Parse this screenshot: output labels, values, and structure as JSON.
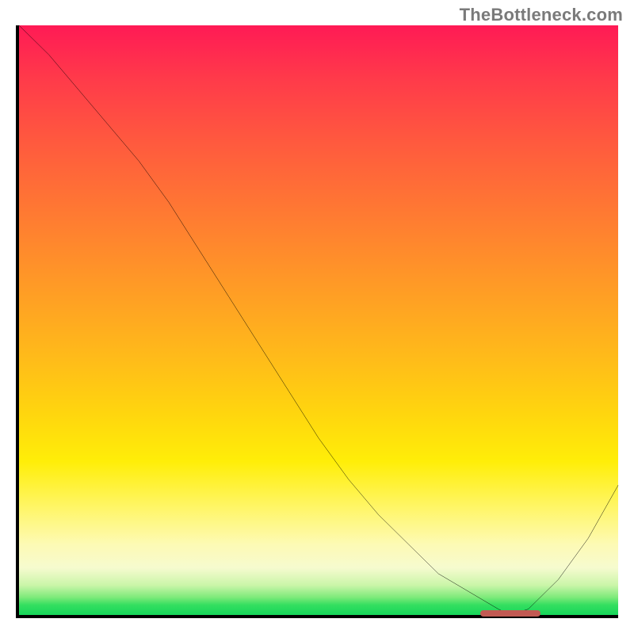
{
  "watermark": "TheBottleneck.com",
  "colors": {
    "axis": "#000000",
    "curve": "#000000",
    "marker": "#c25a53",
    "gradient_top": "#ff1a55",
    "gradient_bottom": "#16d65a"
  },
  "chart_data": {
    "type": "line",
    "title": "",
    "xlabel": "",
    "ylabel": "",
    "xlim": [
      0,
      100
    ],
    "ylim": [
      0,
      100
    ],
    "grid": false,
    "legend": false,
    "series": [
      {
        "name": "curve",
        "x": [
          0,
          5,
          10,
          15,
          20,
          25,
          30,
          35,
          40,
          45,
          50,
          55,
          60,
          65,
          70,
          75,
          80,
          82,
          85,
          90,
          95,
          100
        ],
        "y": [
          100,
          95,
          89,
          83,
          77,
          70,
          62,
          54,
          46,
          38,
          30,
          23,
          17,
          12,
          7,
          4,
          1,
          0,
          1,
          6,
          13,
          22
        ]
      }
    ],
    "annotations": [
      {
        "name": "minimum-band",
        "x_start": 77,
        "x_end": 87,
        "y": 0
      }
    ],
    "notes": "Axes carry no tick labels or titles; x and y are normalized 0–100. Background is a vertical heat gradient from pink/red at top through orange and yellow to a thin green band at the bottom. A short reddish pill marks the curve's minimum near x≈82."
  }
}
